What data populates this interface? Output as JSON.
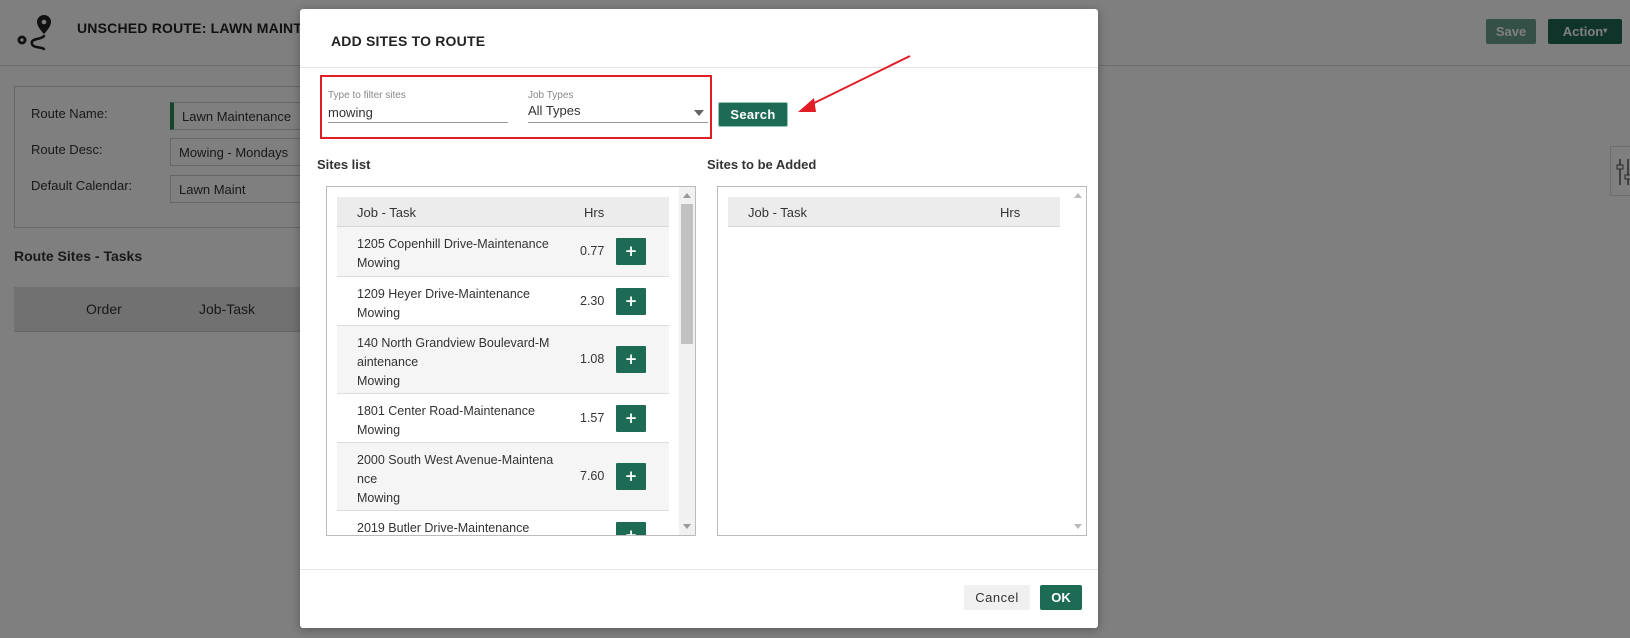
{
  "page": {
    "title": "UNSCHED ROUTE: LAWN MAINTE",
    "save_label": "Save",
    "action_label": "Action",
    "form": {
      "route_name_label": "Route Name:",
      "route_name_value": "Lawn Maintenance",
      "route_desc_label": "Route Desc:",
      "route_desc_value": "Mowing - Mondays",
      "default_calendar_label": "Default Calendar:",
      "default_calendar_value": "Lawn Maint"
    },
    "section_title": "Route Sites - Tasks",
    "table_headers": {
      "order": "Order",
      "job_task": "Job-Task"
    }
  },
  "modal": {
    "title": "ADD SITES TO ROUTE",
    "filter": {
      "label": "Type to filter sites",
      "value": "mowing",
      "job_types_label": "Job Types",
      "job_types_value": "All Types"
    },
    "search_label": "Search",
    "sites_list_title": "Sites list",
    "sites_added_title": "Sites to be Added",
    "col_job_task": "Job - Task",
    "col_hrs": "Hrs",
    "plus_label": "+",
    "sites": [
      {
        "name": "1205 Copenhill Drive-Maintenance",
        "task": "Mowing",
        "hrs": "0.77"
      },
      {
        "name": "1209 Heyer Drive-Maintenance",
        "task": "Mowing",
        "hrs": "2.30"
      },
      {
        "name": "140 North Grandview Boulevard-M",
        "name2": "aintenance",
        "task": "Mowing",
        "hrs": "1.08"
      },
      {
        "name": "1801 Center Road-Maintenance",
        "task": "Mowing",
        "hrs": "1.57"
      },
      {
        "name": "2000 South West Avenue-Maintena",
        "name2": "nce",
        "task": "Mowing",
        "hrs": "7.60"
      },
      {
        "name": "2019 Butler Drive-Maintenance",
        "task": "",
        "hrs": ""
      }
    ],
    "cancel_label": "Cancel",
    "ok_label": "OK"
  },
  "colors": {
    "primary": "#1e6b55",
    "highlight": "#e11d26"
  }
}
